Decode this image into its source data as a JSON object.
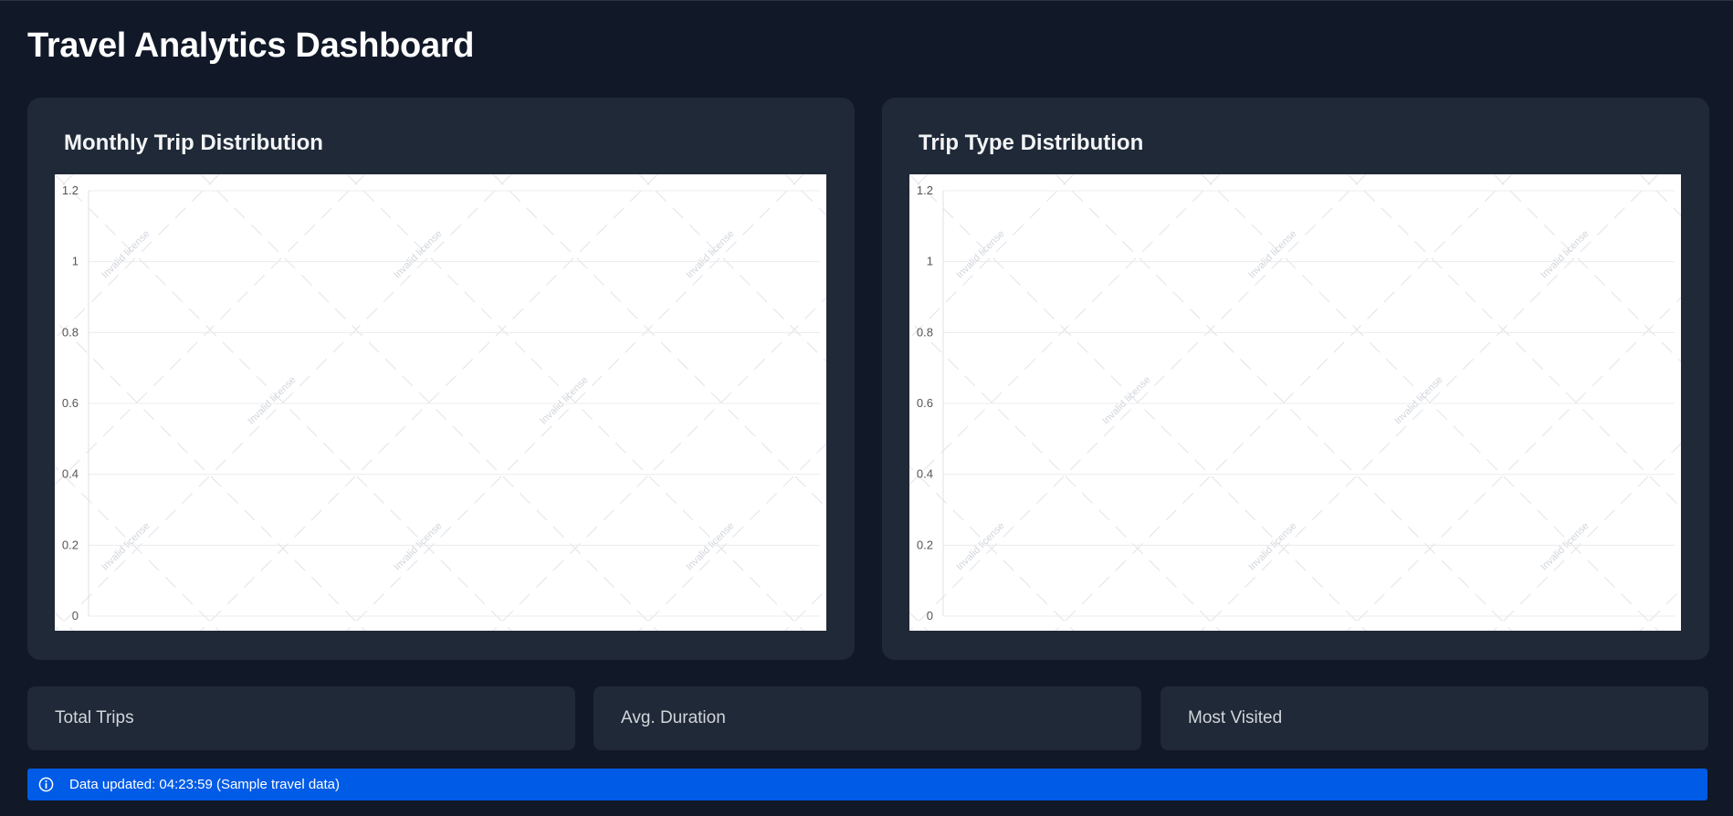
{
  "header": {
    "title": "Travel Analytics Dashboard"
  },
  "charts": [
    {
      "title": "Monthly Trip Distribution"
    },
    {
      "title": "Trip Type Distribution"
    }
  ],
  "chart_data": [
    {
      "type": "bar",
      "title": "Monthly Trip Distribution",
      "categories": [],
      "series": [],
      "ylim": [
        0,
        1.2
      ],
      "yticks": [
        "0",
        "0.2",
        "0.4",
        "0.6",
        "0.8",
        "1",
        "1.2"
      ],
      "grid": true,
      "watermark": "Invalid license"
    },
    {
      "type": "bar",
      "title": "Trip Type Distribution",
      "categories": [],
      "series": [],
      "ylim": [
        0,
        1.2
      ],
      "yticks": [
        "0",
        "0.2",
        "0.4",
        "0.6",
        "0.8",
        "1",
        "1.2"
      ],
      "grid": true,
      "watermark": "Invalid license"
    }
  ],
  "stats": [
    {
      "label": "Total Trips"
    },
    {
      "label": "Avg. Duration"
    },
    {
      "label": "Most Visited"
    }
  ],
  "status": {
    "icon": "info-icon",
    "text": "Data updated: 04:23:59 (Sample travel data)"
  },
  "colors": {
    "background": "#111827",
    "card": "#1f2937",
    "status_bar": "#005be6"
  }
}
